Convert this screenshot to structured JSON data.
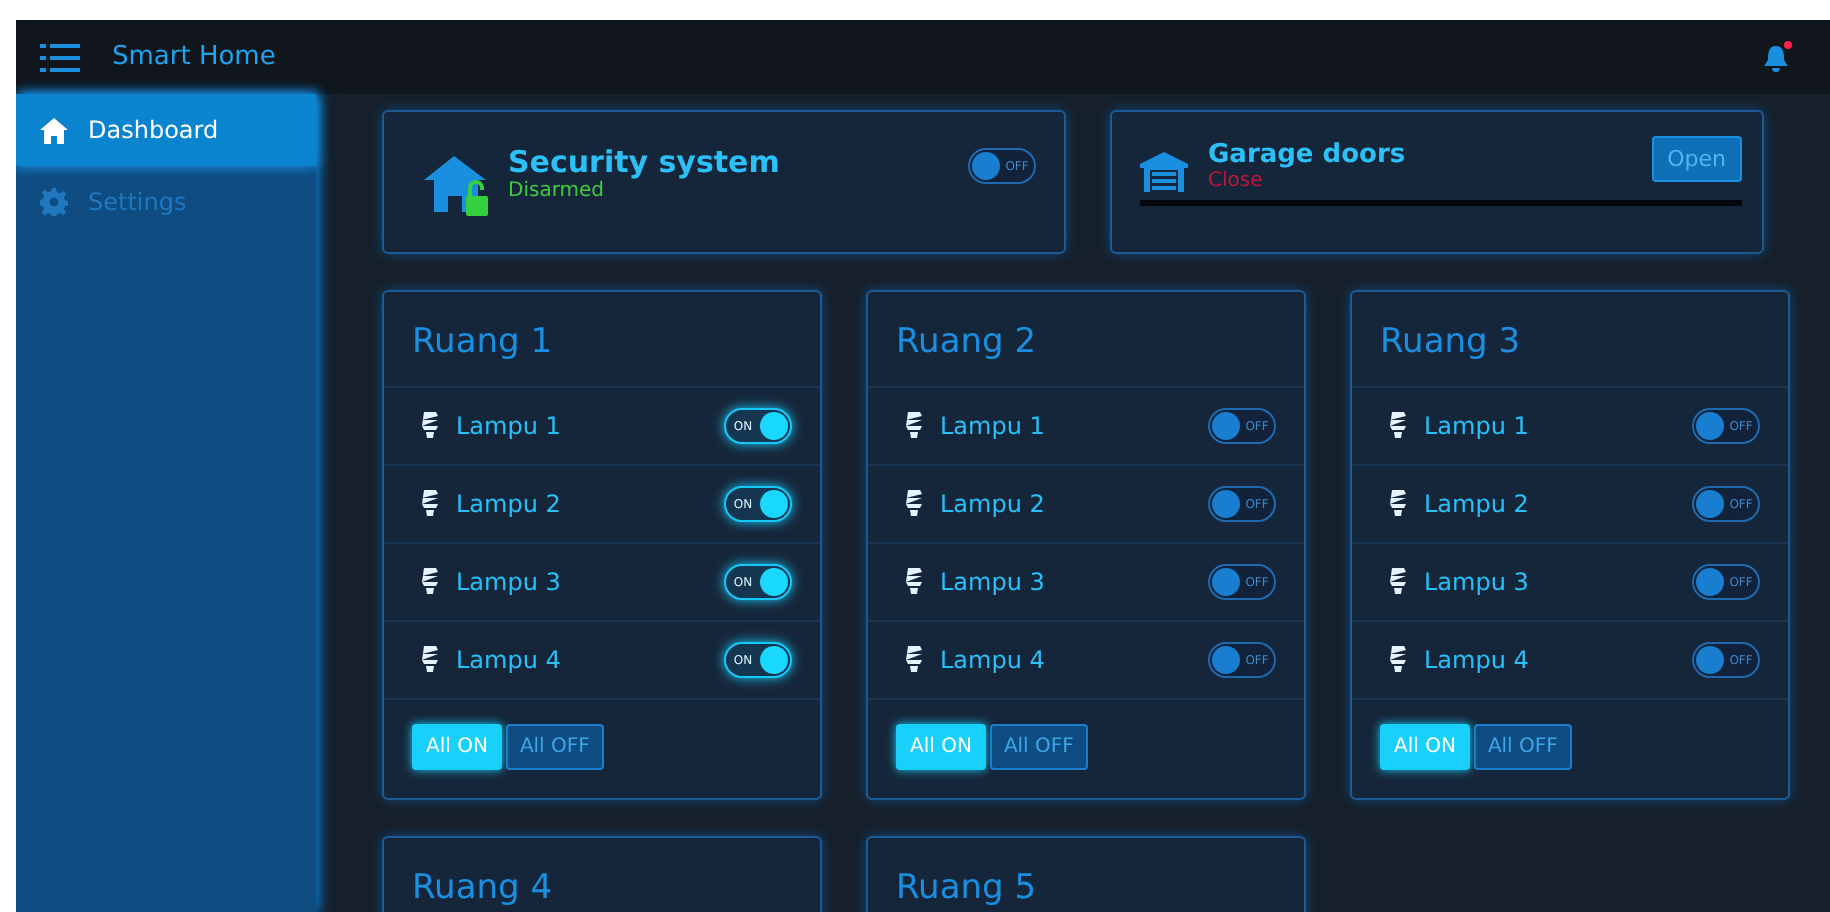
{
  "header": {
    "title": "Smart Home",
    "notification_unread": true
  },
  "sidebar": {
    "items": [
      {
        "label": "Dashboard",
        "selected": true
      },
      {
        "label": "Settings",
        "selected": false
      }
    ]
  },
  "security": {
    "title": "Security system",
    "status": "Disarmed",
    "on": false,
    "switch_text": "OFF"
  },
  "garage": {
    "title": "Garage doors",
    "status": "Close",
    "button": "Open"
  },
  "rooms": [
    {
      "title": "Ruang 1",
      "lamps": [
        {
          "label": "Lampu 1",
          "on": true,
          "switch_text": "ON"
        },
        {
          "label": "Lampu 2",
          "on": true,
          "switch_text": "ON"
        },
        {
          "label": "Lampu 3",
          "on": true,
          "switch_text": "ON"
        },
        {
          "label": "Lampu 4",
          "on": true,
          "switch_text": "ON"
        }
      ],
      "buttons": [
        "All ON",
        "All OFF"
      ]
    },
    {
      "title": "Ruang 2",
      "lamps": [
        {
          "label": "Lampu 1",
          "on": false,
          "switch_text": "OFF"
        },
        {
          "label": "Lampu 2",
          "on": false,
          "switch_text": "OFF"
        },
        {
          "label": "Lampu 3",
          "on": false,
          "switch_text": "OFF"
        },
        {
          "label": "Lampu 4",
          "on": false,
          "switch_text": "OFF"
        }
      ],
      "buttons": [
        "All ON",
        "All OFF"
      ]
    },
    {
      "title": "Ruang 3",
      "lamps": [
        {
          "label": "Lampu 1",
          "on": false,
          "switch_text": "OFF"
        },
        {
          "label": "Lampu 2",
          "on": false,
          "switch_text": "OFF"
        },
        {
          "label": "Lampu 3",
          "on": false,
          "switch_text": "OFF"
        },
        {
          "label": "Lampu 4",
          "on": false,
          "switch_text": "OFF"
        }
      ],
      "buttons": [
        "All ON",
        "All OFF"
      ]
    },
    {
      "title": "Ruang 4"
    },
    {
      "title": "Ruang 5"
    }
  ]
}
